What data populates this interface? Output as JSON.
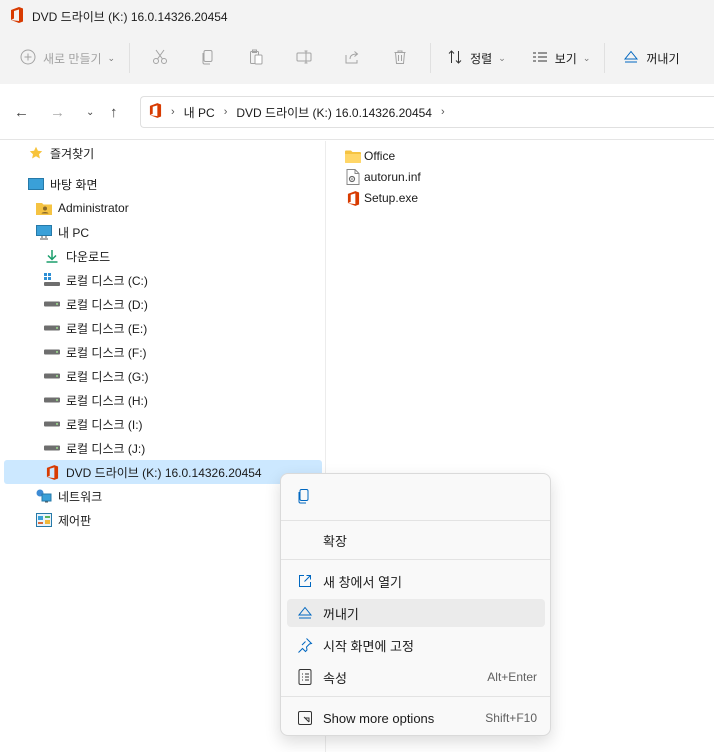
{
  "window": {
    "title": "DVD 드라이브 (K:) 16.0.14326.20454"
  },
  "toolbar": {
    "new_label": "새로 만들기",
    "sort_label": "정렬",
    "view_label": "보기",
    "eject_label": "꺼내기"
  },
  "address": {
    "crumbs": [
      "내 PC",
      "DVD 드라이브 (K:) 16.0.14326.20454"
    ]
  },
  "nav": {
    "favorites": "즐겨찾기",
    "desktop": "바탕 화면",
    "administrator": "Administrator",
    "this_pc": "내 PC",
    "downloads": "다운로드",
    "disks": [
      "로컬 디스크 (C:)",
      "로컬 디스크 (D:)",
      "로컬 디스크 (E:)",
      "로컬 디스크 (F:)",
      "로컬 디스크 (G:)",
      "로컬 디스크 (H:)",
      "로컬 디스크 (I:)",
      "로컬 디스크 (J:)"
    ],
    "dvd": "DVD 드라이브 (K:) 16.0.14326.20454",
    "network": "네트워크",
    "control_panel": "제어판"
  },
  "files": [
    {
      "name": "Office",
      "icon": "folder-icon"
    },
    {
      "name": "autorun.inf",
      "icon": "settings-file-icon"
    },
    {
      "name": "Setup.exe",
      "icon": "office-icon"
    }
  ],
  "context_menu": {
    "expand": "확장",
    "open_new_window": "새 창에서 열기",
    "eject": "꺼내기",
    "pin_start": "시작 화면에 고정",
    "properties": "속성",
    "properties_shortcut": "Alt+Enter",
    "show_more": "Show more options",
    "show_more_shortcut": "Shift+F10"
  },
  "colors": {
    "office_red": "#d83b01",
    "selection": "#cce8ff",
    "folder": "#f5c342",
    "accent": "#0067c0"
  }
}
